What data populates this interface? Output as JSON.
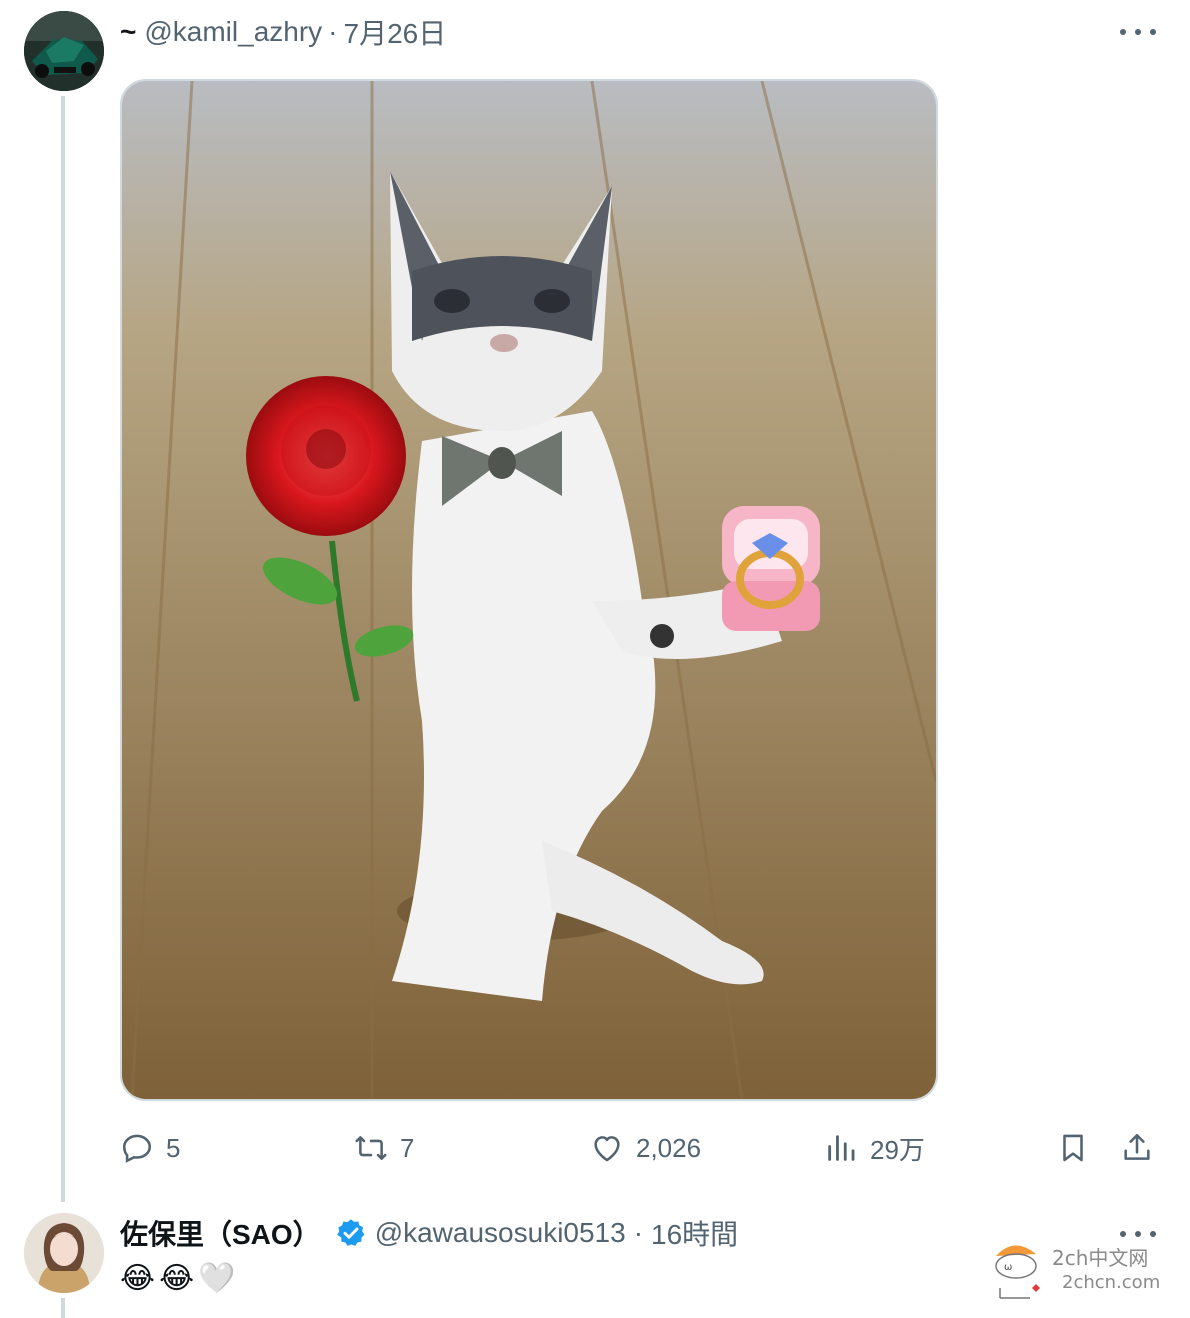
{
  "tweet": {
    "prefix": "~",
    "handle": "@kamil_azhry",
    "separator": "·",
    "date": "7月26日",
    "stats": {
      "replies": "5",
      "retweets": "7",
      "likes": "2,026",
      "views": "29万"
    },
    "icons": {
      "more": "more-dots-icon",
      "reply": "reply-icon",
      "retweet": "retweet-icon",
      "like": "heart-icon",
      "views": "views-chart-icon",
      "bookmark": "bookmark-icon",
      "share": "share-icon"
    }
  },
  "reply_tweet": {
    "display_name": "佐保里（SAO）",
    "verified_icon": "verified-badge-icon",
    "handle": "@kawausosuki0513",
    "separator": "·",
    "time": "16時間",
    "content_emojis": [
      "😂",
      "😂",
      "🤍"
    ]
  },
  "watermark": {
    "line1": "2ch中文网",
    "line2": "2chcn.com"
  },
  "colors": {
    "text_primary": "#0f1419",
    "text_secondary": "#536471",
    "border": "#cfd9de",
    "verified": "#1d9bf0"
  }
}
